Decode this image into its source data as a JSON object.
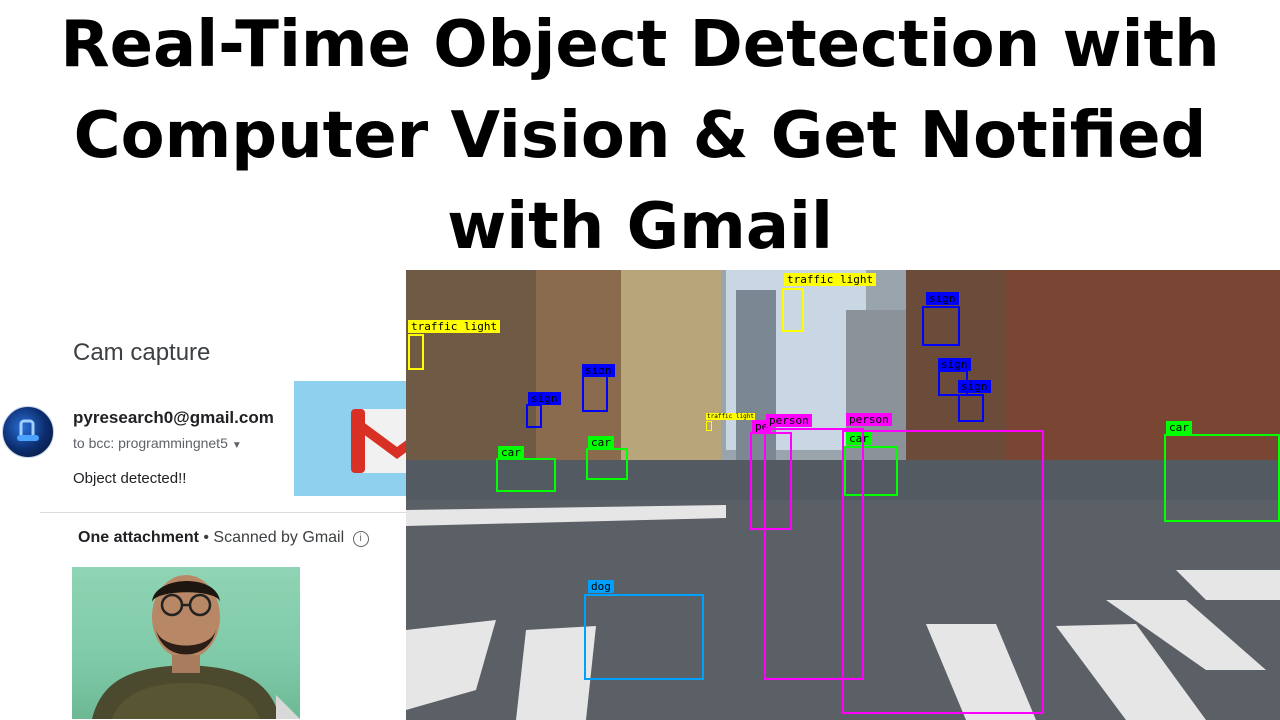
{
  "title": {
    "line1": "Real-Time Object Detection with",
    "line2": "Computer Vision & Get Notified",
    "line3": "with Gmail"
  },
  "email": {
    "subject": "Cam capture",
    "sender": "pyresearch0@gmail.com",
    "to": "to bcc: programmingnet5",
    "body": "Object detected!!",
    "attachment_label": "One attachment",
    "scanned": "• Scanned by Gmail",
    "info_glyph": "i"
  },
  "colors": {
    "person": "#ff00ff",
    "car": "#00ff00",
    "traffic_light": "#ffff00",
    "sign": "#0000ff",
    "dog": "#00a0ff",
    "gmail_red": "#d93025"
  },
  "detections": {
    "traffic_light_1": "traffic light",
    "traffic_light_2": "traffic light",
    "traffic_light_3": "traffic light",
    "sign_1": "sign",
    "sign_2": "sign",
    "sign_3": "sign",
    "sign_4": "sign",
    "sign_5": "sign",
    "car_1": "car",
    "car_2": "car",
    "car_3": "car",
    "car_4": "car",
    "person_1": "person",
    "person_2": "person",
    "person_3": "pe",
    "dog_1": "dog"
  }
}
